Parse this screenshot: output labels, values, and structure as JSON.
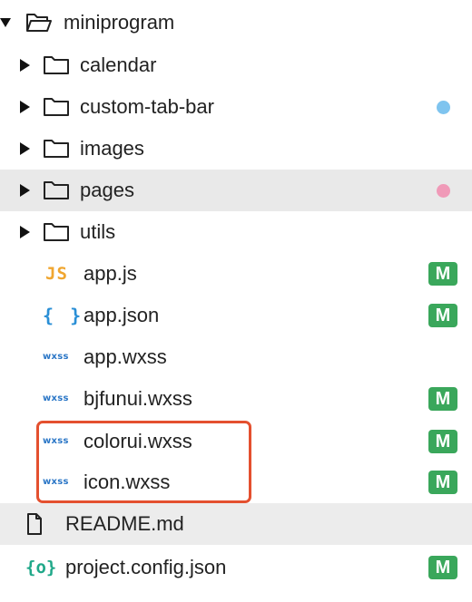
{
  "explorer": {
    "root": {
      "label": "miniprogram",
      "expanded": true
    },
    "folders": [
      {
        "label": "calendar",
        "status": "none"
      },
      {
        "label": "custom-tab-bar",
        "status": "untracked",
        "status_color": "#7fc4ef"
      },
      {
        "label": "images",
        "status": "none"
      },
      {
        "label": "pages",
        "status": "modified-dot",
        "status_color": "#f09ab8",
        "selected": true
      },
      {
        "label": "utils",
        "status": "none"
      }
    ],
    "files": [
      {
        "label": "app.js",
        "icon_text": "JS",
        "icon": "javascript-file-icon",
        "badge": "M"
      },
      {
        "label": "app.json",
        "icon_text": "{ }",
        "icon": "json-file-icon",
        "badge": "M"
      },
      {
        "label": "app.wxss",
        "icon_text": "wxss",
        "icon": "wxss-file-icon",
        "badge": ""
      },
      {
        "label": "bjfunui.wxss",
        "icon_text": "wxss",
        "icon": "wxss-file-icon",
        "badge": "M"
      },
      {
        "label": "colorui.wxss",
        "icon_text": "wxss",
        "icon": "wxss-file-icon",
        "badge": "M"
      },
      {
        "label": "icon.wxss",
        "icon_text": "wxss",
        "icon": "wxss-file-icon",
        "badge": "M"
      }
    ],
    "root_files": [
      {
        "label": "README.md",
        "icon": "document-file-icon",
        "badge": ""
      },
      {
        "label": "project.config.json",
        "icon_text": "{o}",
        "icon": "config-file-icon",
        "badge": "M"
      }
    ],
    "colors": {
      "modified_badge": "#3aa75b",
      "highlight_border": "#e4502f",
      "selected_row": "#e9e9e9"
    }
  }
}
